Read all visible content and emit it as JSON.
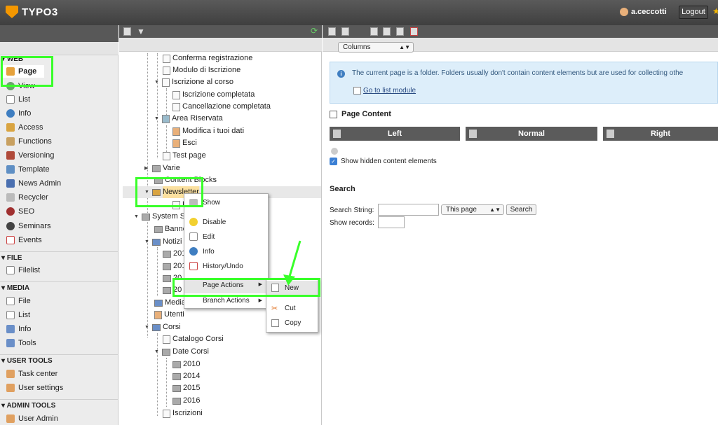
{
  "app": {
    "logo": "TYPO3",
    "user": "a.ceccotti",
    "logout": "Logout"
  },
  "modules": {
    "web": "WEB",
    "web_items": [
      "Page",
      "View",
      "List",
      "Info",
      "Access",
      "Functions",
      "Versioning",
      "Template",
      "News Admin",
      "Recycler",
      "SEO",
      "Seminars",
      "Events"
    ],
    "file": "FILE",
    "file_items": [
      "Filelist"
    ],
    "media": "MEDIA",
    "media_items": [
      "File",
      "List",
      "Info",
      "Tools"
    ],
    "user_tools": "USER TOOLS",
    "user_items": [
      "Task center",
      "User settings"
    ],
    "admin_tools": "ADMIN TOOLS",
    "admin_items": [
      "User Admin"
    ]
  },
  "tree": {
    "n": [
      "Conferma registrazione",
      "Modulo di Iscrizione",
      "Iscrizione al corso",
      "Iscrizione completata",
      "Cancellazione completata",
      "Area Riservata",
      "Modifica i tuoi dati",
      "Esci",
      "Test page",
      "Varie",
      "Content Blocks",
      "Newsletter",
      "System S",
      "Banne",
      "Notizi",
      "201",
      "201",
      "20",
      "20",
      "Media",
      "Utenti",
      "Corsi",
      "Catalogo Corsi",
      "Date Corsi",
      "2010",
      "2014",
      "2015",
      "2016",
      "Iscrizioni"
    ]
  },
  "context_menu": {
    "show": "Show",
    "disable": "Disable",
    "edit": "Edit",
    "info": "Info",
    "history": "History/Undo",
    "page_actions": "Page Actions",
    "branch_actions": "Branch Actions"
  },
  "submenu": {
    "new": "New",
    "cut": "Cut",
    "copy": "Copy"
  },
  "content": {
    "view_select": "Columns",
    "info_text": "The current page is a folder. Folders usually don't contain content elements but are used for collecting othe",
    "info_link": "Go to list module",
    "page_content": "Page Content",
    "cols": [
      "Left",
      "Normal",
      "Right"
    ],
    "show_hidden": "Show hidden content elements",
    "search_title": "Search",
    "search_string_label": "Search String:",
    "scope": "This page",
    "search_button": "Search",
    "show_records_label": "Show records:"
  }
}
